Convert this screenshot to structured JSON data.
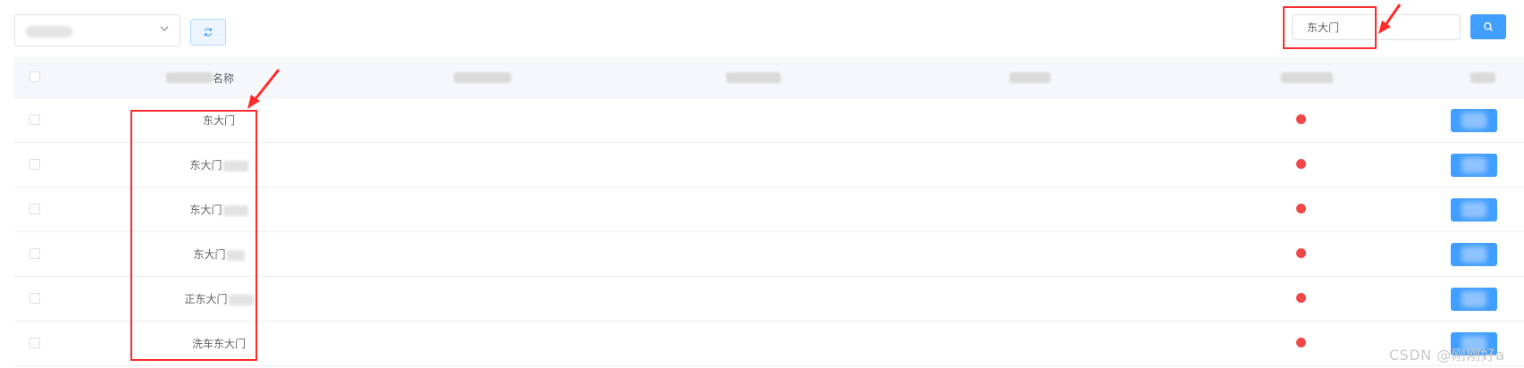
{
  "toolbar": {
    "refresh_icon": "refresh-icon",
    "search": {
      "value": "东大门",
      "icon": "search-icon"
    }
  },
  "table": {
    "header_name_label": "名称",
    "rows": [
      {
        "name": "东大门",
        "status_color": "#f04747"
      },
      {
        "name": "东大门",
        "status_color": "#f04747"
      },
      {
        "name": "东大门",
        "status_color": "#f04747"
      },
      {
        "name": "东大门",
        "status_color": "#f04747"
      },
      {
        "name": "正东大门",
        "status_color": "#f04747"
      },
      {
        "name": "洗车东大门",
        "status_color": "#f04747"
      }
    ]
  },
  "watermark": "CSDN @刚刚好a",
  "colors": {
    "primary": "#409eff",
    "annotation": "#ff2b2b",
    "status_dot": "#f04747"
  }
}
